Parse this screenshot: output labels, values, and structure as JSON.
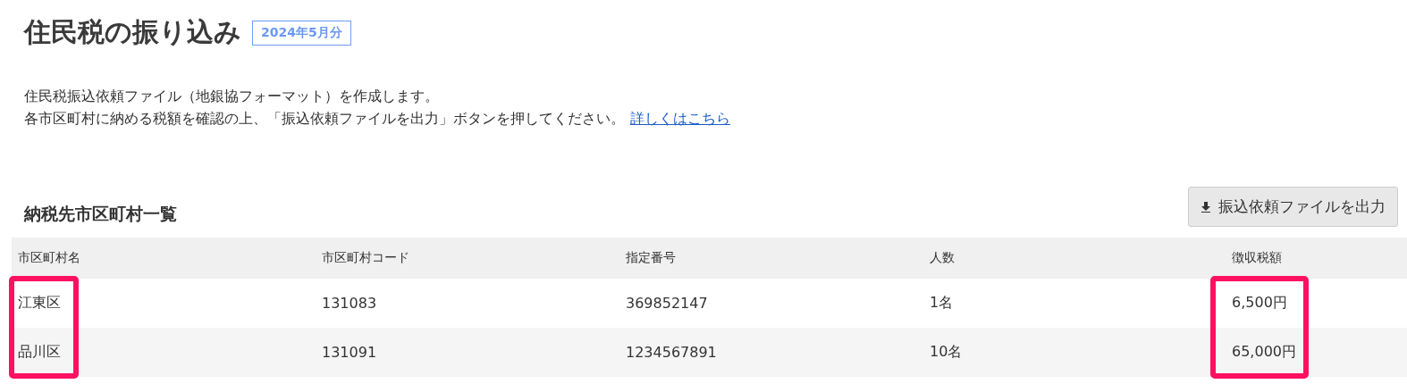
{
  "page": {
    "title": "住民税の振り込み",
    "period_badge": "2024年5月分"
  },
  "description": {
    "lines": [
      "住民税振込依頼ファイル（地銀協フォーマット）を作成します。",
      "各市区町村に納める税額を確認の上、「振込依頼ファイルを出力」ボタンを押してください。"
    ],
    "link": "詳しくはこちら"
  },
  "section": {
    "title": "納税先市区町村一覧",
    "export_button": "振込依頼ファイルを出力"
  },
  "table": {
    "columns": [
      {
        "label": "市区町村名",
        "highlighted": true
      },
      {
        "label": "市区町村コード",
        "highlighted": false
      },
      {
        "label": "指定番号",
        "highlighted": false
      },
      {
        "label": "人数",
        "highlighted": false
      },
      {
        "label": "徴収税額",
        "highlighted": true
      }
    ],
    "rows": [
      [
        "江東区",
        "131083",
        "369852147",
        "1名",
        "6,500円"
      ],
      [
        "品川区",
        "131091",
        "1234567891",
        "10名",
        "65,000円"
      ]
    ]
  }
}
